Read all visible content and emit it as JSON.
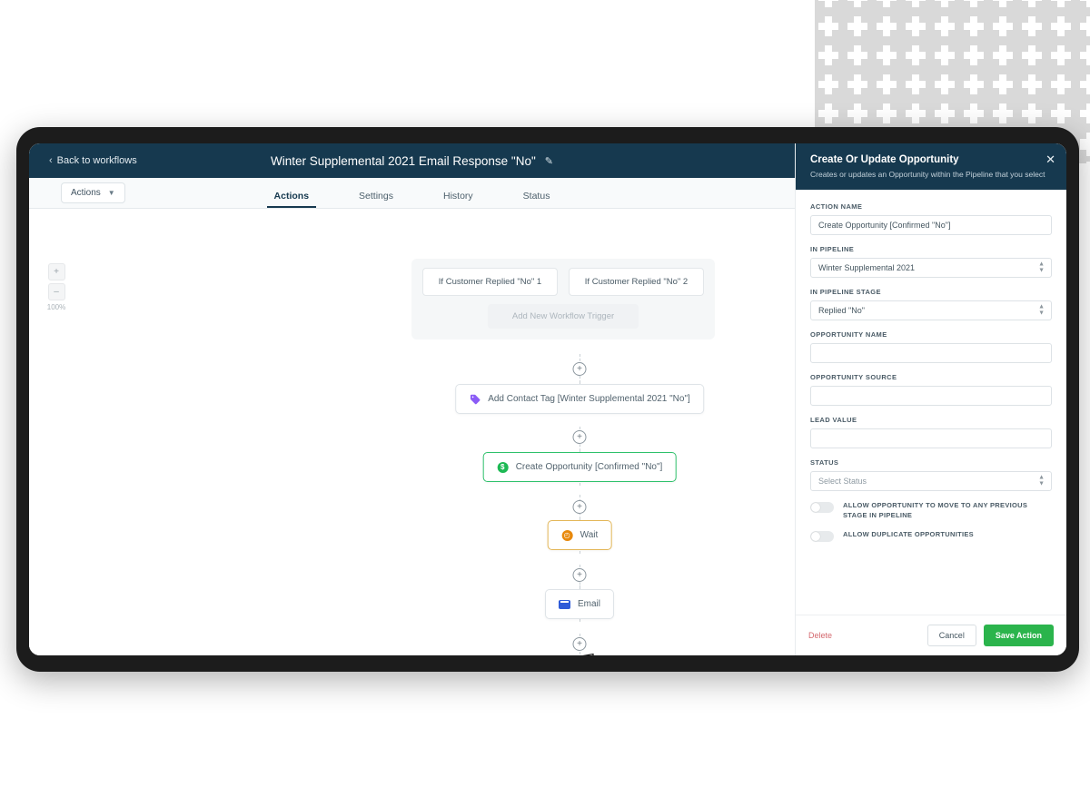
{
  "decor": {
    "plus_icon": "plus-icon"
  },
  "app": {
    "back_label": "Back to workflows",
    "back_chevron": "‹",
    "workflow_title": "Winter Supplemental 2021 Email Response \"No\"",
    "edit_icon": "✎",
    "actions_button": "Actions",
    "actions_caret": "▼",
    "tabs": [
      {
        "label": "Actions",
        "active": true
      },
      {
        "label": "Settings",
        "active": false
      },
      {
        "label": "History",
        "active": false
      },
      {
        "label": "Status",
        "active": false
      }
    ],
    "zoom": {
      "in": "+",
      "out": "–",
      "level": "100%"
    },
    "triggers": [
      "If Customer Replied \"No\" 1",
      "If Customer Replied \"No\" 2"
    ],
    "add_trigger": "Add New Workflow Trigger",
    "nodes": [
      {
        "label": "Add Contact Tag [Winter Supplemental 2021 \"No\"]",
        "icon": "tag-icon",
        "state": "default"
      },
      {
        "label": "Create Opportunity [Confirmed \"No\"]",
        "icon": "dollar-icon",
        "state": "selected"
      },
      {
        "label": "Wait",
        "icon": "clock-icon",
        "state": "wait"
      },
      {
        "label": "Email",
        "icon": "envelope-icon",
        "state": "default"
      }
    ],
    "connector_plus": "+",
    "end_marker": "checkered-flag-icon"
  },
  "panel": {
    "title": "Create Or Update Opportunity",
    "subtitle": "Creates or updates an Opportunity within the Pipeline that you select",
    "close_icon": "✕",
    "fields": [
      {
        "label": "ACTION NAME",
        "value": "Create Opportunity [Confirmed \"No\"]",
        "type": "text"
      },
      {
        "label": "IN PIPELINE",
        "value": "Winter Supplemental 2021",
        "type": "select"
      },
      {
        "label": "IN PIPELINE STAGE",
        "value": "Replied \"No\"",
        "type": "select"
      },
      {
        "label": "OPPORTUNITY NAME",
        "value": "",
        "type": "tag"
      },
      {
        "label": "OPPORTUNITY SOURCE",
        "value": "",
        "type": "tag"
      },
      {
        "label": "LEAD VALUE",
        "value": "",
        "type": "tag"
      },
      {
        "label": "STATUS",
        "value": "Select Status",
        "type": "select",
        "placeholder": true
      }
    ],
    "toggles": [
      {
        "label": "ALLOW OPPORTUNITY TO MOVE TO ANY PREVIOUS STAGE IN PIPELINE",
        "on": false
      },
      {
        "label": "ALLOW DUPLICATE OPPORTUNITIES",
        "on": false
      }
    ],
    "footer": {
      "delete": "Delete",
      "cancel": "Cancel",
      "save": "Save Action"
    }
  },
  "colors": {
    "header_navy": "#16394f",
    "save_green": "#2bb44c",
    "selected_green": "#2ec16b",
    "wait_amber": "#e3b657",
    "tag_purple": "#8b5cf6",
    "mail_blue": "#2f5bd8",
    "delete_red": "#d4686e"
  }
}
